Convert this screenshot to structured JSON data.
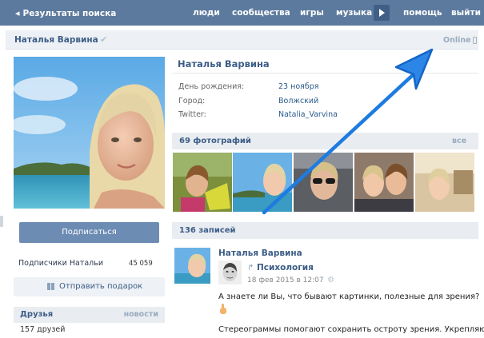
{
  "nav": {
    "back_label": "Результаты поиска",
    "items": [
      "люди",
      "сообщества",
      "игры",
      "музыка",
      "помощь",
      "выйти"
    ]
  },
  "header": {
    "name": "Наталья Варвина",
    "status": "Online"
  },
  "left": {
    "subscribe_label": "Подписаться",
    "followers_label": "Подписчики Натальи",
    "followers_count": "45 059",
    "gift_label": "Отправить подарок",
    "friends_title": "Друзья",
    "friends_news": "новости",
    "friends_count": "157 друзей"
  },
  "profile": {
    "name": "Наталья Варвина",
    "info": [
      {
        "label": "День рождения:",
        "value": "23 ноября"
      },
      {
        "label": "Город:",
        "value": "Волжский"
      },
      {
        "label": "Twitter:",
        "value": "Natalia_Varvina"
      }
    ]
  },
  "photos": {
    "title": "69 фотографий",
    "all_label": "все"
  },
  "posts": {
    "title": "136 записей",
    "author": "Наталья Варвина",
    "group": "Психология",
    "date": "18 фев 2015 в 12:07",
    "text": "А знаете ли Вы, что бывают картинки, полезные для зрения?",
    "text_2": "Стереограммы помогают сохранить остроту зрения. Укрепляют"
  },
  "colors": {
    "nav_bg": "#5c7a9e",
    "accent": "#3c5d86",
    "button": "#6d8cb4",
    "annotation": "#1e7be0"
  },
  "icons": [
    "chevron-left-icon",
    "play-icon",
    "checkmark-icon",
    "phone-icon",
    "gift-icon",
    "repost-icon",
    "gear-icon",
    "pointing-finger-icon"
  ]
}
